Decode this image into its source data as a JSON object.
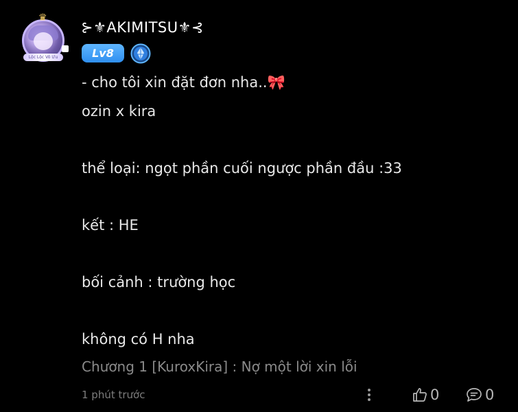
{
  "comment": {
    "user": {
      "name": "⊱⚜AKIMITSU⚜⊰",
      "level": "Lv8",
      "frame_caption": "Lộc Lộc Vô Ưu"
    },
    "lines": [
      "- cho tôi xin đặt đơn nha..",
      "ozin x kira",
      "thể loại: ngọt phần cuối ngược phần đầu :33",
      "kết : HE",
      "bối cảnh : trường học",
      "không có H nha"
    ],
    "ribbon_emoji": "🎀",
    "chapter_ref": "Chương 1 [KuroxKira] : Nợ một lời xin lỗi",
    "timestamp": "1 phút trước",
    "likes": "0",
    "replies": "0"
  },
  "colors": {
    "background": "#000000",
    "text_primary": "#e8e8e8",
    "text_muted": "#8a8a8a",
    "level_badge": "#3a9bf5",
    "ribbon": "#f06fa0"
  },
  "icons": {
    "more": "more-vertical-icon",
    "like": "thumbs-up-icon",
    "comment": "comment-bubble-icon",
    "badge": "crystal-badge-icon"
  }
}
